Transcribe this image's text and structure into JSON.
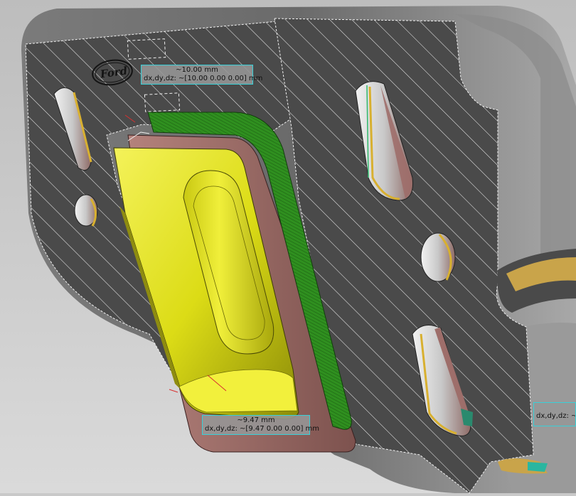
{
  "viewport": {
    "logo_text": "Ford",
    "measurements": [
      {
        "distance": "~10.00 mm",
        "delta": "dx,dy,dz: ~[10.00 0.00 0.00] mm"
      },
      {
        "distance": "~9.47 mm",
        "delta": "dx,dy,dz: ~[9.47 0.00 0.00] mm"
      },
      {
        "distance": "",
        "delta": "dx,dy,dz: ~["
      }
    ]
  },
  "colors": {
    "background": "#c9c9c9",
    "body": "#6a6a6a",
    "section": "#4a4a4a",
    "hatch": "#e8e8e8",
    "part_yellow": "#e3e21a",
    "part_green": "#2e8e1e",
    "flange_rose": "#9e6e6a",
    "label_border": "#38d0d8"
  }
}
